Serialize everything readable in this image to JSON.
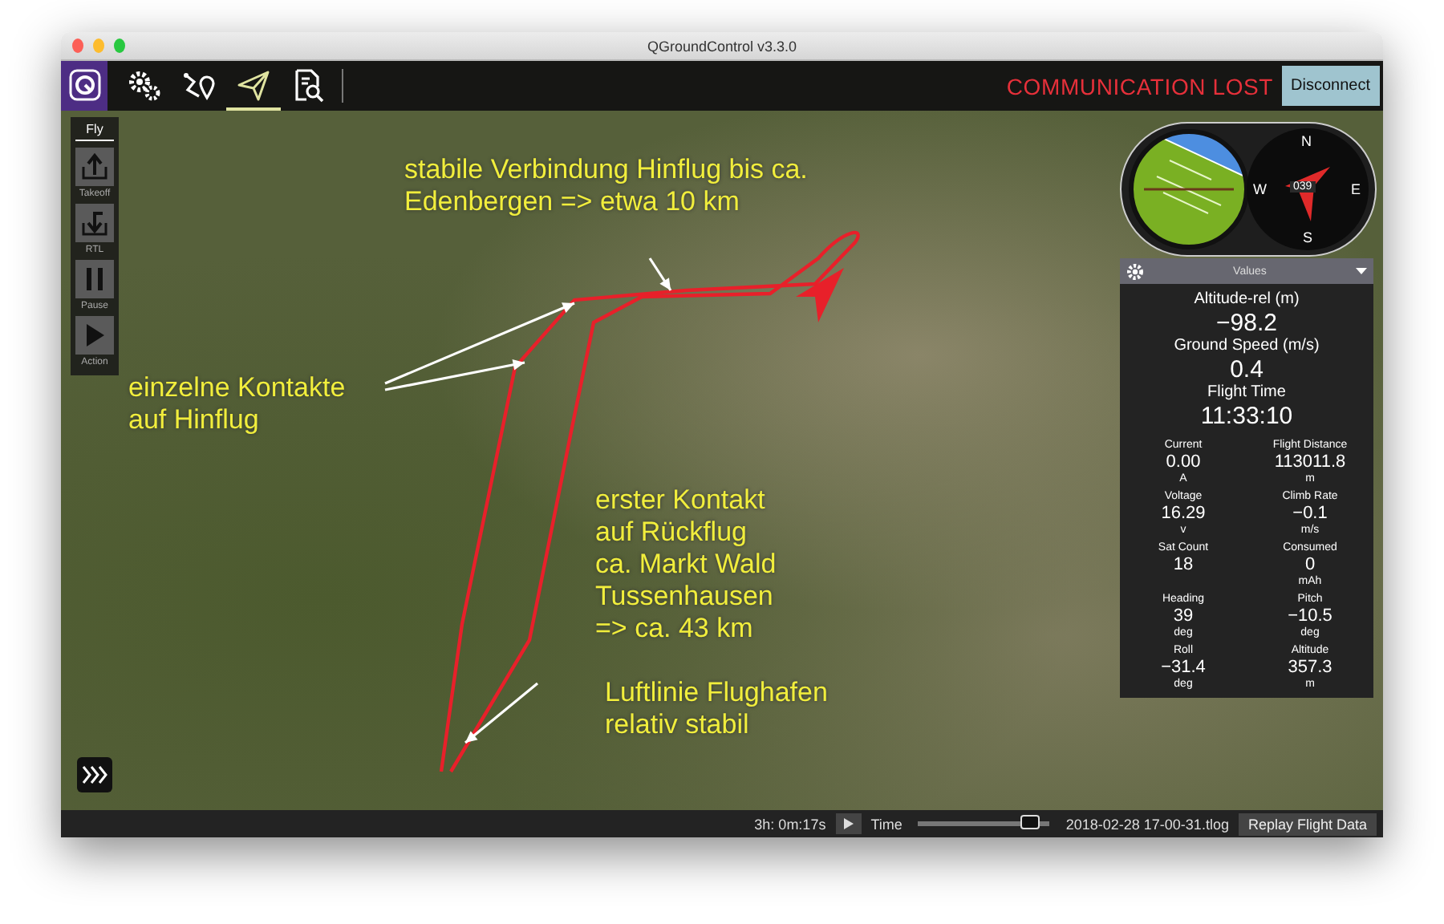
{
  "window": {
    "title": "QGroundControl v3.3.0"
  },
  "toolbar": {
    "tools": [
      {
        "kind": "logo",
        "selected": false
      },
      {
        "kind": "settings",
        "selected": false
      },
      {
        "kind": "plan",
        "selected": false
      },
      {
        "kind": "fly",
        "selected": true
      },
      {
        "kind": "analyze",
        "selected": false
      }
    ],
    "status": "COMMUNICATION LOST",
    "button": "Disconnect"
  },
  "fly_panel": {
    "title": "Fly",
    "actions": [
      {
        "kind": "takeoff",
        "label": "Takeoff"
      },
      {
        "kind": "rtl",
        "label": "RTL"
      },
      {
        "kind": "pause",
        "label": "Pause"
      },
      {
        "kind": "action",
        "label": "Action"
      }
    ]
  },
  "instruments": {
    "compass": {
      "north": "N",
      "east": "E",
      "south": "S",
      "west": "W",
      "heading": "039"
    }
  },
  "values_panel": {
    "title": "Values",
    "primary": [
      {
        "label": "Altitude-rel (m)",
        "value": "−98.2"
      },
      {
        "label": "Ground Speed (m/s)",
        "value": "0.4"
      },
      {
        "label": "Flight Time",
        "value": "11:33:10"
      }
    ],
    "secondary": [
      {
        "label": "Current",
        "value": "0.00",
        "unit": "A"
      },
      {
        "label": "Flight Distance",
        "value": "113011.8",
        "unit": "m"
      },
      {
        "label": "Voltage",
        "value": "16.29",
        "unit": "v"
      },
      {
        "label": "Climb Rate",
        "value": "−0.1",
        "unit": "m/s"
      },
      {
        "label": "Sat Count",
        "value": "18"
      },
      {
        "label": "Consumed",
        "value": "0",
        "unit": "mAh"
      },
      {
        "label": "Heading",
        "value": "39",
        "unit": "deg"
      },
      {
        "label": "Pitch",
        "value": "−10.5",
        "unit": "deg"
      },
      {
        "label": "Roll",
        "value": "−31.4",
        "unit": "deg"
      },
      {
        "label": "Altitude",
        "value": "357.3",
        "unit": "m"
      }
    ]
  },
  "annotations": [
    {
      "text": "stabile Verbindung Hinflug bis ca.\nEdenbergen => etwa 10 km"
    },
    {
      "text": "einzelne Kontakte\nauf Hinflug"
    },
    {
      "text": "erster Kontakt\nauf Rückflug\nca. Markt Wald\nTussenhausen\n=> ca. 43 km"
    },
    {
      "text": "Luftlinie Flughafen\nrelativ stabil"
    }
  ],
  "bottom_bar": {
    "elapsed": "3h: 0m:17s",
    "time_label": "Time",
    "time_slider": {
      "level": 0.92
    },
    "file": "2018-02-28 17-00-31.tlog",
    "button": "Replay Flight Data"
  }
}
